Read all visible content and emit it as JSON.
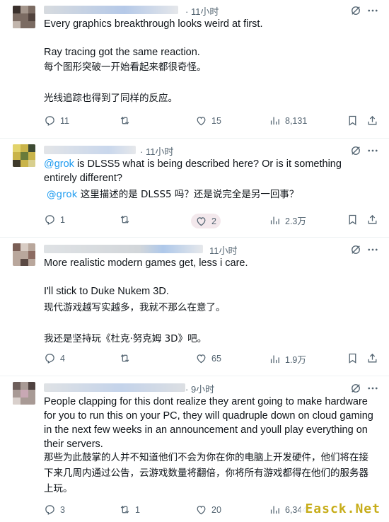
{
  "tweets": [
    {
      "time": "· 11小时",
      "text_en": "Every graphics breakthrough looks weird at first.\n\nRay tracing got the same reaction.",
      "text_zh": "每个图形突破一开始看起来都很奇怪。\n\n光线追踪也得到了同样的反应。",
      "replies": "11",
      "reposts": "",
      "likes": "15",
      "views": "8,131"
    },
    {
      "time": "· 11小时",
      "mention": "@grok",
      "text_en": " is DLSS5 what is being described here? Or is it something entirely different?",
      "mention_zh": "@grok",
      "text_zh": " 这里描述的是 DLSS5 吗？还是说完全是另一回事？",
      "replies": "1",
      "reposts": "",
      "likes": "2",
      "views": "2.3万"
    },
    {
      "time": "11小时",
      "text_en": "More realistic modern games get, less i care.\n\nI'll stick to Duke Nukem 3D.",
      "text_zh": "现代游戏越写实越多，我就不那么在意了。\n\n我还是坚持玩《杜克·努克姆 3D》吧。",
      "replies": "4",
      "reposts": "",
      "likes": "65",
      "views": "1.9万"
    },
    {
      "time": "· 9小时",
      "text_en": "People clapping for this dont realize they arent going to make hardware for you to run this on your PC, they will quadruple down on cloud gaming in the next few weeks in an announcement and youll play everything on their servers.",
      "text_zh": "那些为此鼓掌的人并不知道他们不会为你在你的电脑上开发硬件，他们将在接下来几周内通过公告，云游戏数量将翻倍，你将所有游戏都得在他们的服务器上玩。",
      "replies": "3",
      "reposts": "1",
      "likes": "20",
      "views": "6,344"
    }
  ],
  "watermark": "Easck.Net",
  "colors": {
    "accent": "#1d9bf0",
    "muted": "#536471",
    "text": "#0f1419",
    "divider": "#eff3f4"
  }
}
